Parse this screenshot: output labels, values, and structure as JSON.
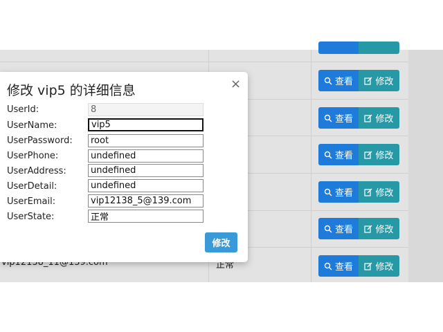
{
  "background": {
    "view_label": "查看",
    "edit_label": "修改",
    "partial_email": "vip12138_11@139.com",
    "partial_state": "正常"
  },
  "modal": {
    "title": "修改 vip5 的详细信息",
    "close_glyph": "×",
    "fields": [
      {
        "label": "UserId:",
        "value": "8"
      },
      {
        "label": "UserName:",
        "value": "vip5"
      },
      {
        "label": "UserPassword:",
        "value": "root"
      },
      {
        "label": "UserPhone:",
        "value": "undefined"
      },
      {
        "label": "UserAddress:",
        "value": "undefined"
      },
      {
        "label": "UserDetail:",
        "value": "undefined"
      },
      {
        "label": "UserEmail:",
        "value": "vip12138_5@139.com"
      },
      {
        "label": "UserState:",
        "value": "正常"
      }
    ],
    "submit_label": "修改"
  },
  "colors": {
    "view_button": "#1f7bd9",
    "edit_button": "#2799a6",
    "submit_button": "#3a9ad9"
  },
  "icons": {
    "view": "search-icon",
    "edit": "edit-icon",
    "close": "close-icon"
  }
}
